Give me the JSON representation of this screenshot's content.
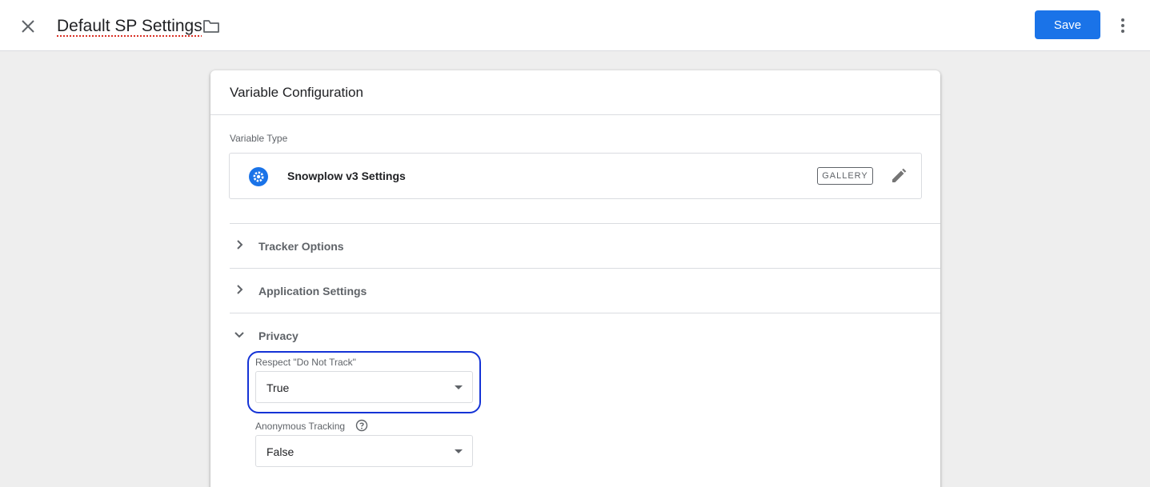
{
  "header": {
    "title": "Default SP Settings",
    "save_label": "Save"
  },
  "card": {
    "title": "Variable Configuration",
    "variable_type_label": "Variable Type",
    "variable_type_name": "Snowplow v3 Settings",
    "gallery_label": "GALLERY"
  },
  "sections": [
    {
      "label": "Tracker Options",
      "expanded": false
    },
    {
      "label": "Application Settings",
      "expanded": false
    },
    {
      "label": "Privacy",
      "expanded": true
    }
  ],
  "privacy": {
    "dnt_label": "Respect \"Do Not Track\"",
    "dnt_value": "True",
    "anon_label": "Anonymous Tracking",
    "anon_value": "False"
  },
  "icons": [
    "close-icon",
    "folder-icon",
    "more-vert-icon",
    "gear-icon",
    "edit-pencil-icon",
    "chevron-right-icon",
    "chevron-down-icon",
    "help-circle-icon",
    "dropdown-arrow-icon"
  ],
  "colors": {
    "accent": "#1a73e8",
    "highlight": "#1433d6"
  }
}
